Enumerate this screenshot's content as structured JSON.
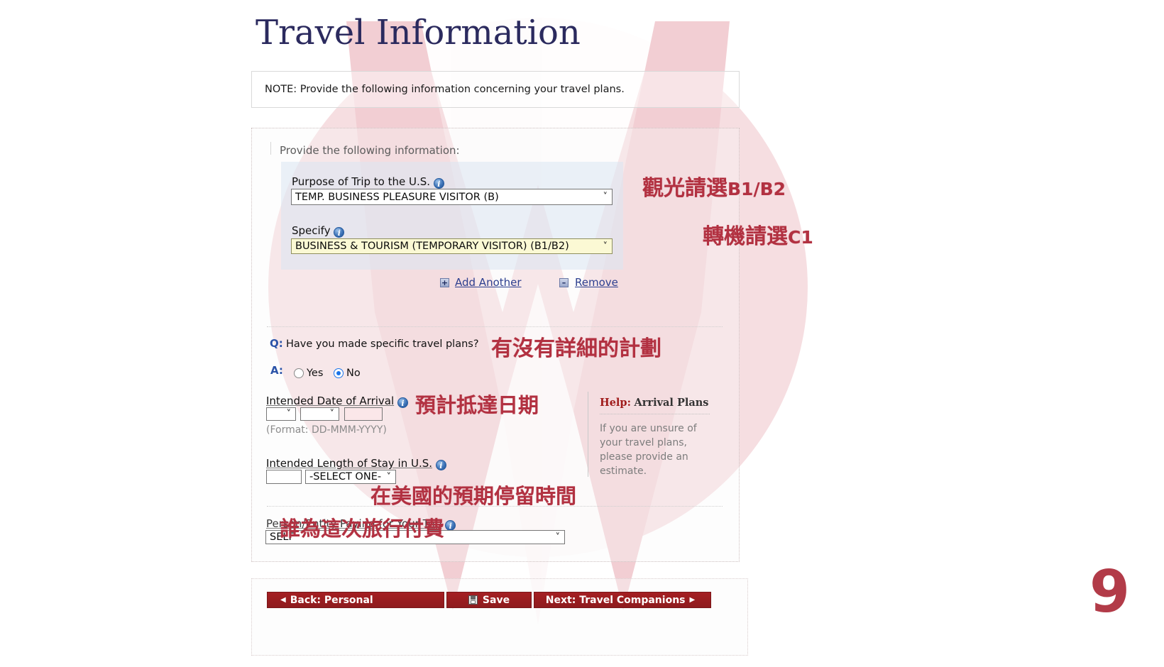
{
  "document": {
    "title": "Travel Information",
    "page_number": "9",
    "accent_red": "#b23141",
    "title_color": "#2b2a5e",
    "button_color": "#a51f22"
  },
  "note": {
    "text": "NOTE: Provide the following information concerning your travel plans."
  },
  "form": {
    "section_label": "Provide the following information:",
    "purpose": {
      "label": "Purpose of Trip to the U.S.",
      "info_icon": "info-icon",
      "value": "TEMP. BUSINESS PLEASURE VISITOR (B)"
    },
    "specify": {
      "label": "Specify",
      "info_icon": "info-icon",
      "value": "BUSINESS & TOURISM (TEMPORARY VISITOR) (B1/B2)"
    },
    "add_another": "Add Another",
    "remove": "Remove",
    "plus_glyph": "+",
    "minus_glyph": "–",
    "question": {
      "q_letter": "Q:",
      "q_text": "Have you made specific travel plans?",
      "a_letter": "A:",
      "option_yes": "Yes",
      "option_no": "No",
      "selected": "No"
    },
    "arrival": {
      "label": "Intended Date of Arrival",
      "day_value": "",
      "month_value": "",
      "year_value": "",
      "format_hint": "(Format: DD-MMM-YYYY)"
    },
    "length_of_stay": {
      "label": "Intended Length of Stay in U.S.",
      "number_value": "",
      "unit_value": "-SELECT ONE-"
    },
    "payer": {
      "label": "Person/Entity Paying for Your Trip",
      "value": "SELF"
    }
  },
  "help": {
    "title_prefix": "Help:",
    "title": "Arrival Plans",
    "body": "If you are unsure of your travel plans, please provide an estimate."
  },
  "annotations": [
    {
      "text": "觀光請選",
      "suffix": "B1/B2",
      "name": "annotation-tourism"
    },
    {
      "text": "轉機請選",
      "suffix": "C1",
      "name": "annotation-transit"
    },
    {
      "text": "有沒有詳細的計劃",
      "suffix": "",
      "name": "annotation-specific-plans"
    },
    {
      "text": "預計抵達日期",
      "suffix": "",
      "name": "annotation-arrival-date"
    },
    {
      "text": "在美國的預期停留時間",
      "suffix": "",
      "name": "annotation-length-of-stay"
    },
    {
      "text": "誰為這次旅行付費",
      "suffix": "",
      "name": "annotation-who-pays"
    }
  ],
  "nav": {
    "back": "Back: Personal",
    "save": "Save",
    "next": "Next: Travel Companions",
    "back_arrow": "◀",
    "next_arrow": "▶"
  }
}
